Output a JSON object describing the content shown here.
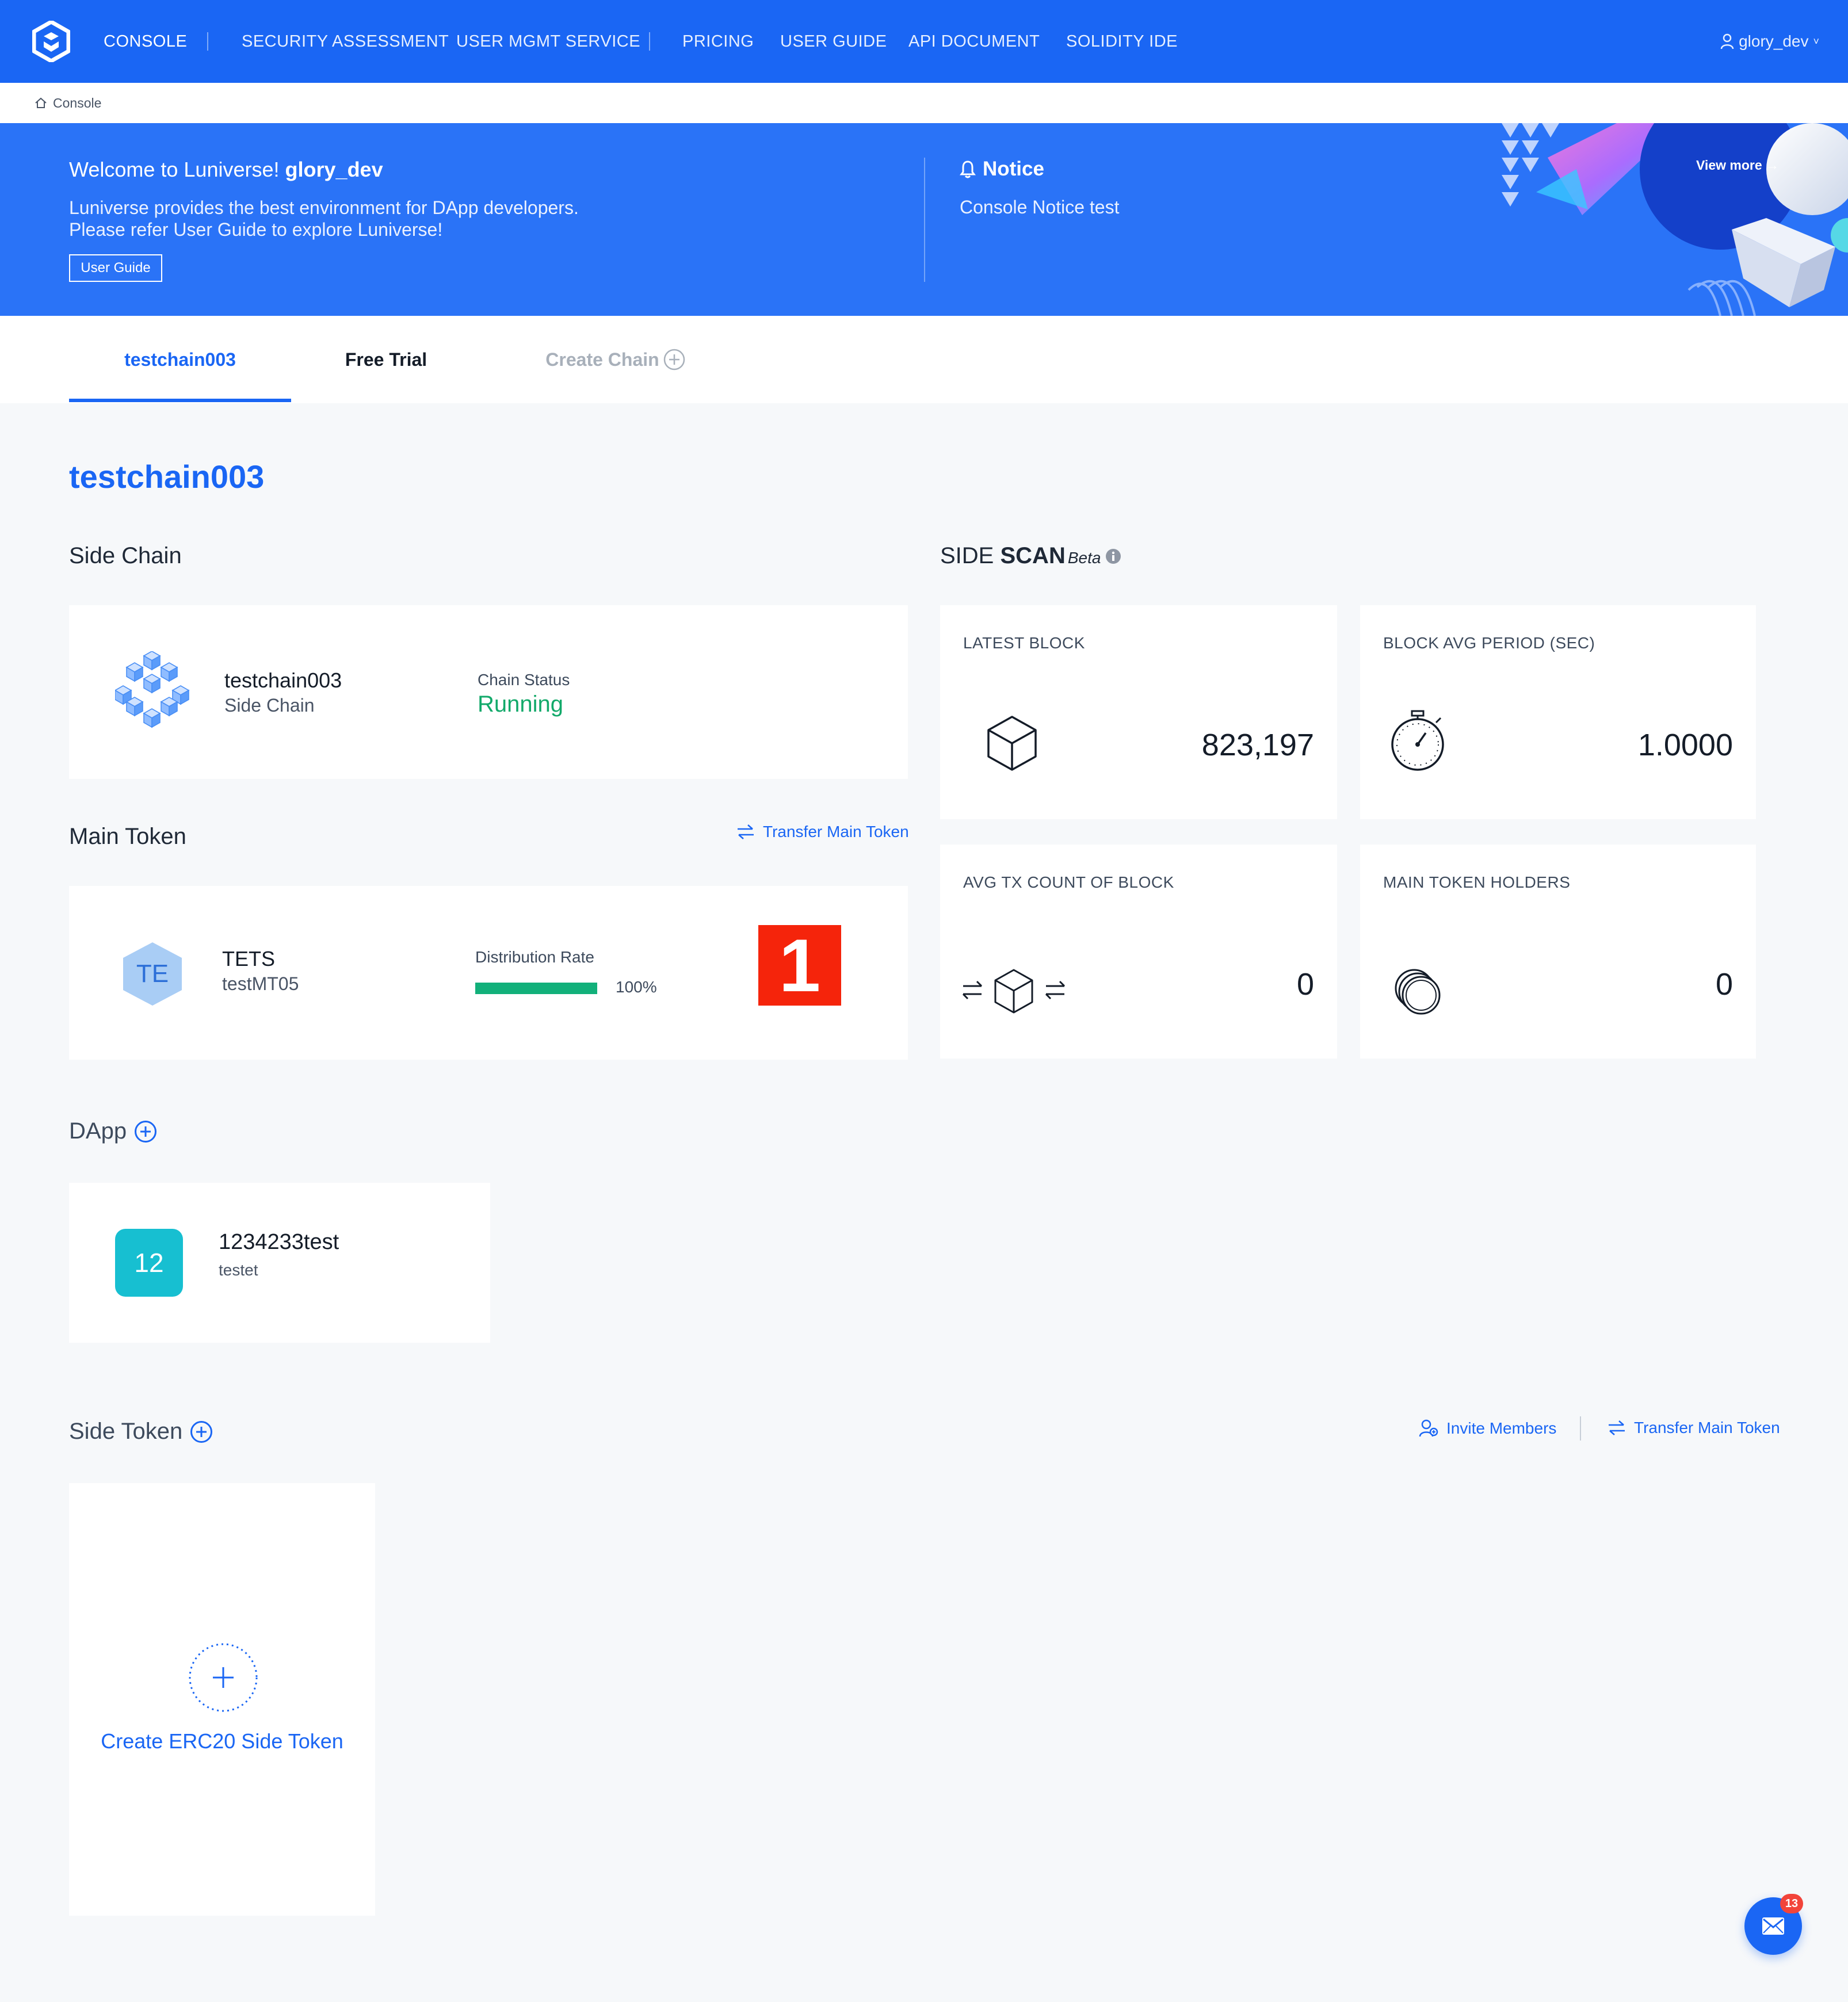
{
  "nav": {
    "items": [
      {
        "label": "CONSOLE"
      },
      {
        "label": "SECURITY ASSESSMENT"
      },
      {
        "label": "USER MGMT SERVICE"
      },
      {
        "label": "PRICING"
      },
      {
        "label": "USER GUIDE"
      },
      {
        "label": "API DOCUMENT"
      },
      {
        "label": "SOLIDITY IDE"
      }
    ],
    "user": "glory_dev",
    "accent": "#1a66f4"
  },
  "breadcrumb": {
    "label": "Console",
    "icon": "home-icon"
  },
  "banner": {
    "welcome_prefix": "Welcome to Luniverse!",
    "username": "glory_dev",
    "desc_line1": "Luniverse provides the best environment for DApp developers.",
    "desc_line2": "Please refer User Guide to explore Luniverse!",
    "button_label": "User Guide",
    "notice_title": "Notice",
    "notice_text": "Console Notice test",
    "view_more": "View more →"
  },
  "tabs": [
    {
      "label": "testchain003",
      "state": "active"
    },
    {
      "label": "Free Trial",
      "state": "normal"
    },
    {
      "label": "Create Chain",
      "state": "disabled"
    }
  ],
  "page_title": "testchain003",
  "side_chain": {
    "section_title": "Side Chain",
    "name": "testchain003",
    "type": "Side Chain",
    "status_label": "Chain Status",
    "status_value": "Running",
    "status_color": "#12a96a"
  },
  "side_scan": {
    "title_prefix": "SIDE ",
    "title_bold": "SCAN",
    "title_beta": "Beta",
    "cards": [
      {
        "label": "LATEST BLOCK",
        "value": "823,197",
        "icon": "cube-icon"
      },
      {
        "label": "BLOCK AVG PERIOD (SEC)",
        "value": "1.0000",
        "icon": "stopwatch-icon"
      },
      {
        "label": "AVG TX COUNT OF BLOCK",
        "value": "0",
        "icon": "transfer-cube-icon"
      },
      {
        "label": "MAIN TOKEN HOLDERS",
        "value": "0",
        "icon": "coins-icon"
      }
    ]
  },
  "main_token": {
    "section_title": "Main Token",
    "transfer_link": "Transfer Main Token",
    "avatar": "TE",
    "symbol": "TETS",
    "name": "testMT05",
    "dist_label": "Distribution Rate",
    "dist_rate": 1.0,
    "dist_text": "100%",
    "badge": "1",
    "badge_color": "#f5240b"
  },
  "dapp": {
    "section_title": "DApp",
    "avatar": "12",
    "name": "1234233test",
    "desc": "testet",
    "avatar_color": "#17bfd1"
  },
  "side_token": {
    "section_title": "Side Token",
    "invite_link": "Invite Members",
    "transfer_link": "Transfer Main Token",
    "create_label": "Create ERC20 Side Token"
  },
  "chat": {
    "badge": "13",
    "icon": "mail-icon"
  }
}
